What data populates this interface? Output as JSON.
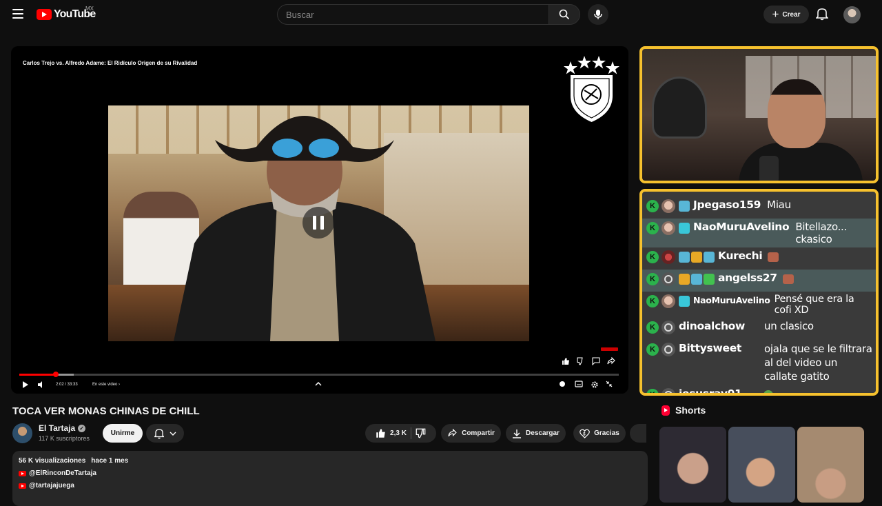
{
  "header": {
    "logo_text": "YouTube",
    "country": "MX",
    "search_placeholder": "Buscar",
    "create_label": "Crear"
  },
  "player": {
    "overlay_title": "Carlos Trejo vs.  Alfredo Adame: El Ridículo Origen de su Rivalidad",
    "time": "2:02 / 33:33",
    "chapter": "En este video",
    "progress": {
      "played_fraction": 0.061,
      "buffered_fraction": 0.091
    }
  },
  "video": {
    "title": "TOCA VER MONAS CHINAS DE CHILL",
    "channel": "El Tartaja",
    "subscribers": "117 K suscriptores",
    "join_label": "Unirme",
    "likes": "2,3 K",
    "share_label": "Compartir",
    "download_label": "Descargar",
    "thanks_label": "Gracias"
  },
  "description": {
    "views": "56 K visualizaciones",
    "age": "hace 1 mes",
    "links": [
      "@ElRinconDeTartaja",
      "@tartajajuega"
    ]
  },
  "chat": [
    {
      "user": "Jpegaso159",
      "text": "Miau"
    },
    {
      "user": "NaoMuruAvelino",
      "text": "Bitellazo... ckasico"
    },
    {
      "user": "Kurechi",
      "text": ""
    },
    {
      "user": "angelss27",
      "text": ""
    },
    {
      "user": "NaoMuruAvelino",
      "text": "Pensé que era la cofi XD"
    },
    {
      "user": "dinoalchow",
      "text": "un clasico"
    },
    {
      "user": "Bittysweet",
      "text": "ojala que se le filtrara al del video un callate gatito"
    },
    {
      "user": "jesusray01",
      "text": ""
    }
  ],
  "chat_badge_letter": "K",
  "shorts": {
    "title": "Shorts"
  },
  "colors": {
    "accent": "#ff0000",
    "chat_border": "#f6c12e",
    "chat_badge": "#2bb24c"
  }
}
